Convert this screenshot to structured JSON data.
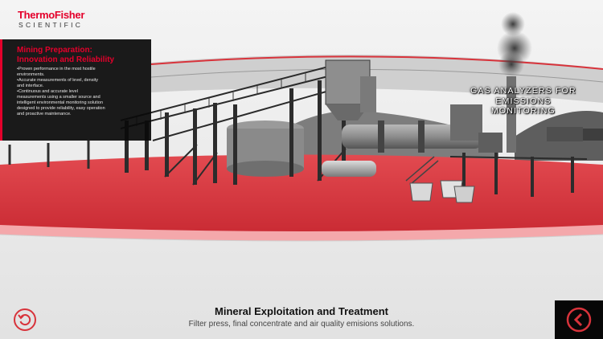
{
  "brand": {
    "line1": "ThermoFisher",
    "line2": "SCIENTIFIC"
  },
  "info_panel": {
    "title_line1": "Mining Preparation:",
    "title_line2": "Innovation and Reliability",
    "bullets": [
      "Proven performance in the most hostile",
      "environments.",
      "Accurate measurements of level, density",
      "and interface.",
      "Continuous and accurate level",
      "measurements using a smaller source and",
      "intelligent environmental monitoring solution",
      "designed to provide reliability, easy operation",
      "and proactive maintenance."
    ]
  },
  "callout": {
    "line1": "GAS ANALYZERS FOR",
    "line2": "EMISSIONS",
    "line3": "MONITORING"
  },
  "footer": {
    "title": "Mineral Exploitation and Treatment",
    "subtitle": "Filter press, final concentrate and air quality emisions solutions."
  },
  "colors": {
    "brand_red": "#e4002b",
    "floor_red": "#d8333b",
    "panel_black": "#0a0a0a"
  },
  "icons": {
    "reset": "rotate-ccw-icon",
    "next": "chevron-left-circle-icon"
  }
}
